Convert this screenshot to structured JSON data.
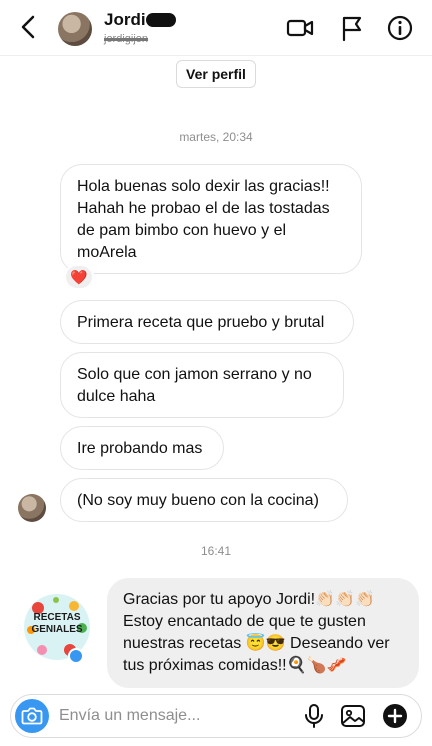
{
  "header": {
    "name": "Jordi",
    "username": "jordigijon"
  },
  "profile_button": "Ver perfil",
  "timestamps": {
    "first": "martes, 20:34",
    "second": "16:41"
  },
  "messages": [
    {
      "text": "Hola buenas solo dexir las gracias!! Hahah he probao el de las tostadas de pam bimbo con huevo y el moArela",
      "reaction": "❤️"
    },
    {
      "text": "Primera receta que pruebo y brutal"
    },
    {
      "text": "Solo que con jamon serrano y no dulce haha"
    },
    {
      "text": "Ire probando mas"
    },
    {
      "text": "(No soy muy bueno con la cocina)"
    }
  ],
  "reply": {
    "text": "Gracias por tu apoyo Jordi!👏🏻👏🏻👏🏻 Estoy encantado de que te gusten nuestras recetas 😇😎 Deseando ver tus próximas comidas!!🍳🍗🥓",
    "sender_logo_text": "RECETAS GENIALES"
  },
  "composer": {
    "placeholder": "Envía un mensaje..."
  },
  "icons": [
    "back-icon",
    "video-call-icon",
    "flag-icon",
    "info-icon",
    "camera-icon",
    "microphone-icon",
    "gallery-icon",
    "plus-icon"
  ],
  "colors": {
    "accent": "#3897f0",
    "sent_bubble": "#efefef",
    "border": "#e4e4e4"
  }
}
